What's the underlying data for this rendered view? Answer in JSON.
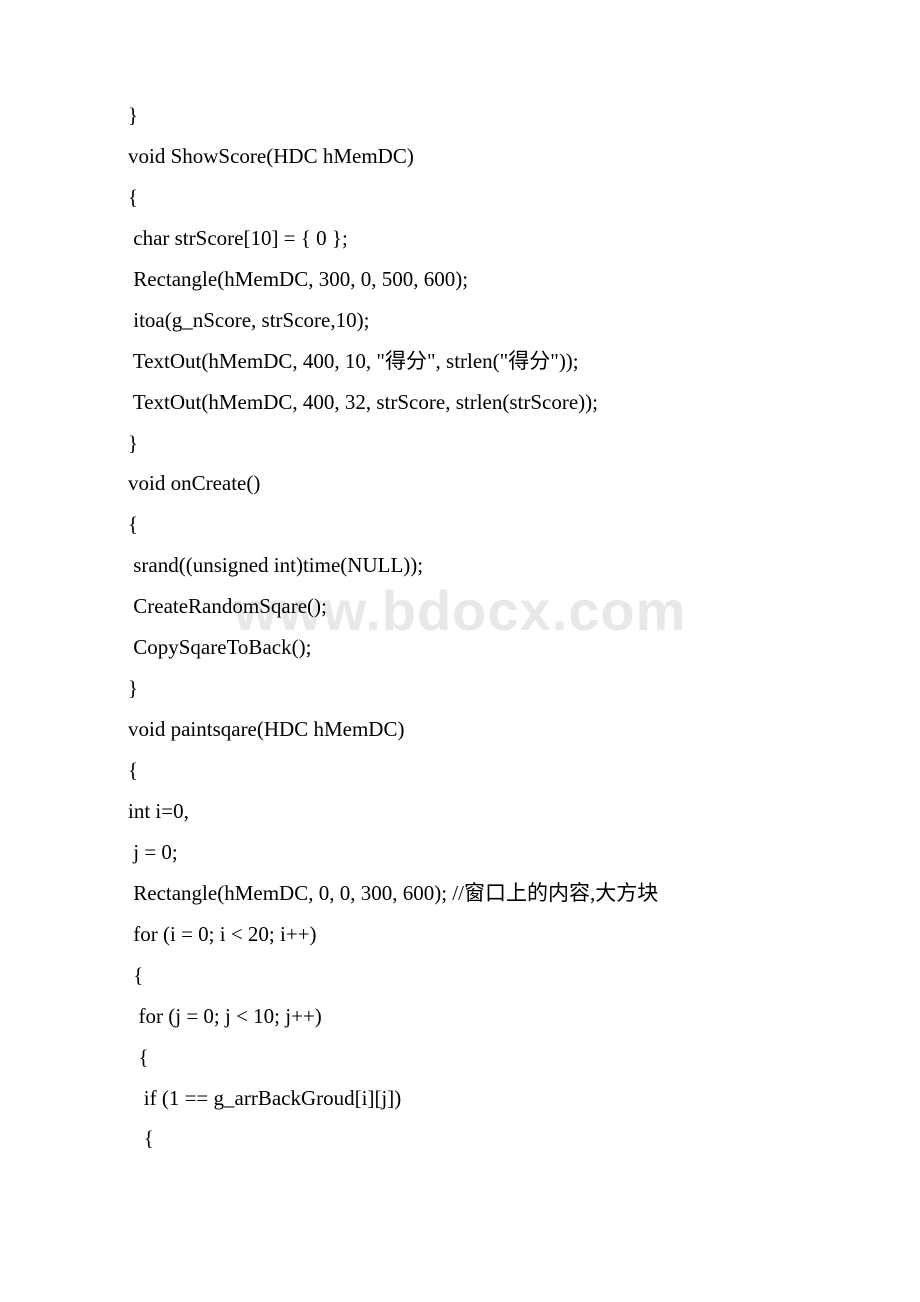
{
  "watermark": "www.bdocx.com",
  "lines": [
    "}",
    "void ShowScore(HDC hMemDC)",
    "{",
    " char strScore[10] = { 0 };",
    " Rectangle(hMemDC, 300, 0, 500, 600);",
    " itoa(g_nScore, strScore,10);",
    " TextOut(hMemDC, 400, 10, \"得分\", strlen(\"得分\"));",
    " TextOut(hMemDC, 400, 32, strScore, strlen(strScore));",
    "}",
    "void onCreate()",
    "{",
    " srand((unsigned int)time(NULL));",
    " CreateRandomSqare();",
    " CopySqareToBack();",
    "}",
    "void paintsqare(HDC hMemDC)",
    "{",
    "int i=0,",
    " j = 0;",
    " Rectangle(hMemDC, 0, 0, 300, 600); //窗口上的内容,大方块",
    " for (i = 0; i < 20; i++)",
    " {",
    "  for (j = 0; j < 10; j++)",
    "  {",
    "   if (1 == g_arrBackGroud[i][j])",
    "   {"
  ]
}
